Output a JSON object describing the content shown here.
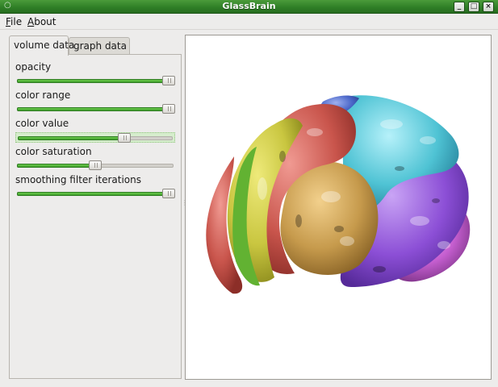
{
  "window": {
    "title": "GlassBrain"
  },
  "window_controls": {
    "minimize": "_",
    "maximize": "□",
    "close": "×"
  },
  "menubar": {
    "file": {
      "accel": "F",
      "rest": "ile"
    },
    "about": {
      "accel": "A",
      "rest": "bout"
    }
  },
  "tabs": {
    "volume": "volume data",
    "graph": "graph data",
    "active": "volume data"
  },
  "controls": [
    {
      "label": "opacity",
      "value": 1.0
    },
    {
      "label": "color range",
      "value": 1.0
    },
    {
      "label": "color value",
      "value": 0.7
    },
    {
      "label": "color saturation",
      "value": 0.5
    },
    {
      "label": "smoothing filter iterations",
      "value": 1.0
    }
  ],
  "viewport": {
    "content": "3D rendered brain with colored lobes",
    "colors": {
      "frontal_yellow": "#c9c640",
      "frontal_red": "#c9554c",
      "temporal_gold": "#c69a4c",
      "parietal_cyan": "#4fc3d4",
      "occipital_purple": "#8c4fd6",
      "top_blue": "#4a66c8",
      "cerebellum_magenta": "#c65fd0",
      "green_strip": "#62b232"
    }
  },
  "accent_color": "#4caf3c"
}
